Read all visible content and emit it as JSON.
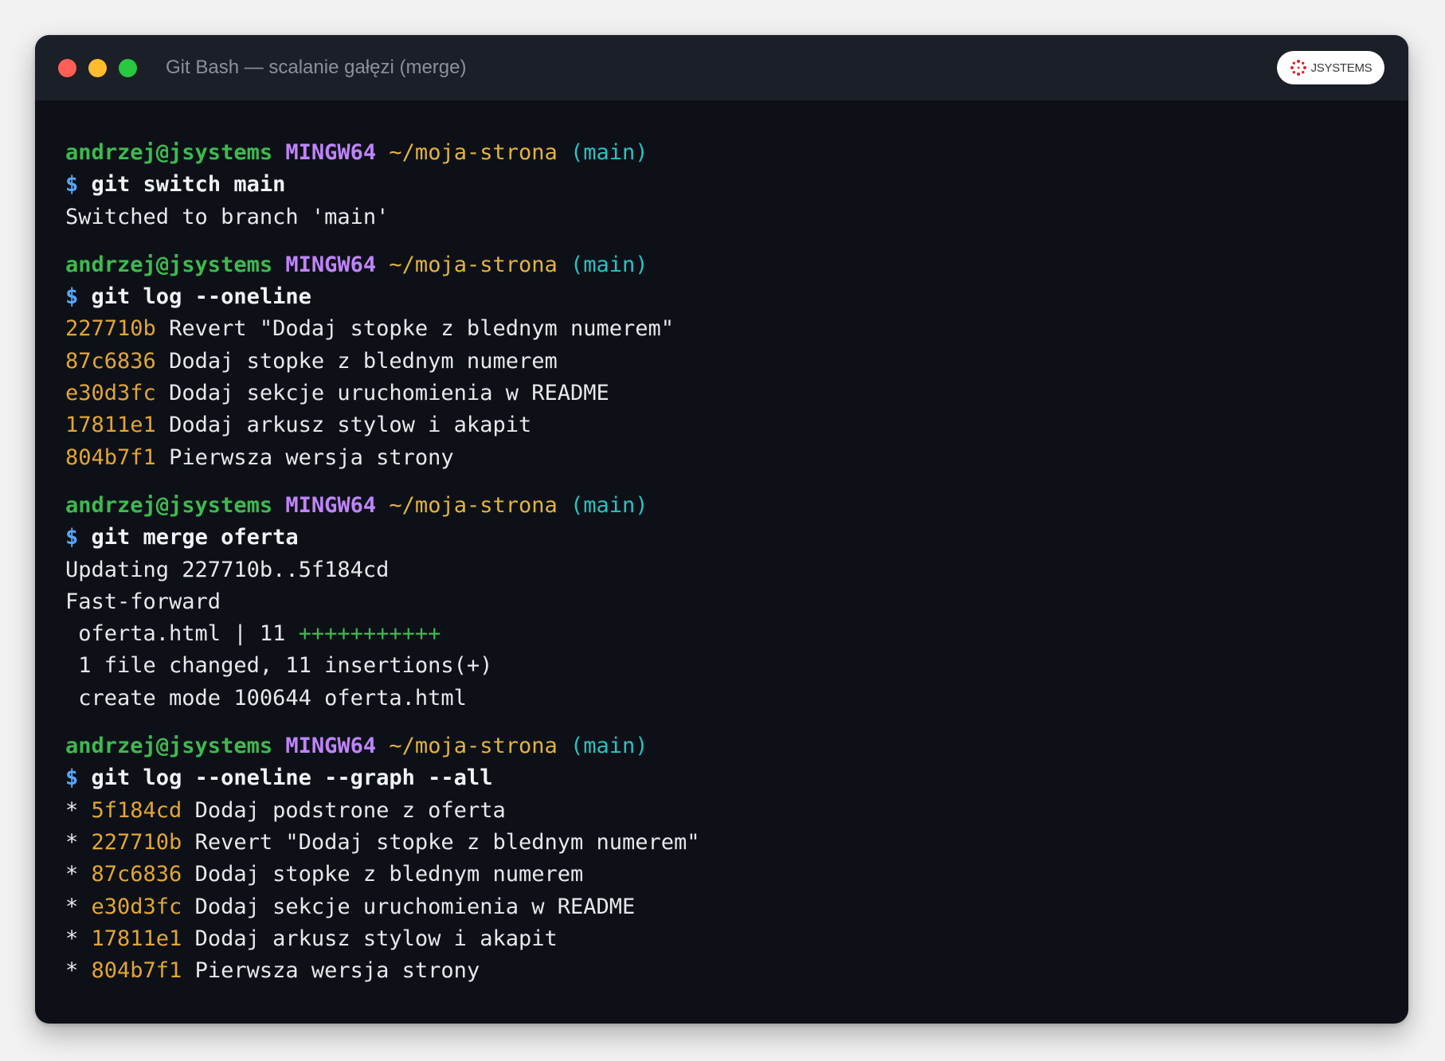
{
  "window": {
    "title": "Git Bash — scalanie gałęzi (merge)",
    "logo_text": "JSYSTEMS"
  },
  "prompt": {
    "user_host": "andrzej@jsystems",
    "system": "MINGW64",
    "path": "~/moja-strona",
    "branch": "(main)",
    "dollar": "$"
  },
  "blocks": [
    {
      "command": "git switch main",
      "output": [
        "Switched to branch 'main'"
      ]
    },
    {
      "command": "git log --oneline",
      "log": [
        {
          "hash": "227710b",
          "message": "Revert \"Dodaj stopke z blednym numerem\""
        },
        {
          "hash": "87c6836",
          "message": "Dodaj stopke z blednym numerem"
        },
        {
          "hash": "e30d3fc",
          "message": "Dodaj sekcje uruchomienia w README"
        },
        {
          "hash": "17811e1",
          "message": "Dodaj arkusz stylow i akapit"
        },
        {
          "hash": "804b7f1",
          "message": "Pierwsza wersja strony"
        }
      ]
    },
    {
      "command": "git merge oferta",
      "output": [
        "Updating 227710b..5f184cd",
        "Fast-forward"
      ],
      "diffstat": {
        "file": " oferta.html | 11 ",
        "plus": "+++++++++++"
      },
      "summary": [
        " 1 file changed, 11 insertions(+)",
        " create mode 100644 oferta.html"
      ]
    },
    {
      "command": "git log --oneline --graph --all",
      "graph_marker": "* ",
      "log": [
        {
          "hash": "5f184cd",
          "message": "Dodaj podstrone z oferta"
        },
        {
          "hash": "227710b",
          "message": "Revert \"Dodaj stopke z blednym numerem\""
        },
        {
          "hash": "87c6836",
          "message": "Dodaj stopke z blednym numerem"
        },
        {
          "hash": "e30d3fc",
          "message": "Dodaj sekcje uruchomienia w README"
        },
        {
          "hash": "17811e1",
          "message": "Dodaj arkusz stylow i akapit"
        },
        {
          "hash": "804b7f1",
          "message": "Pierwsza wersja strony"
        }
      ]
    }
  ]
}
